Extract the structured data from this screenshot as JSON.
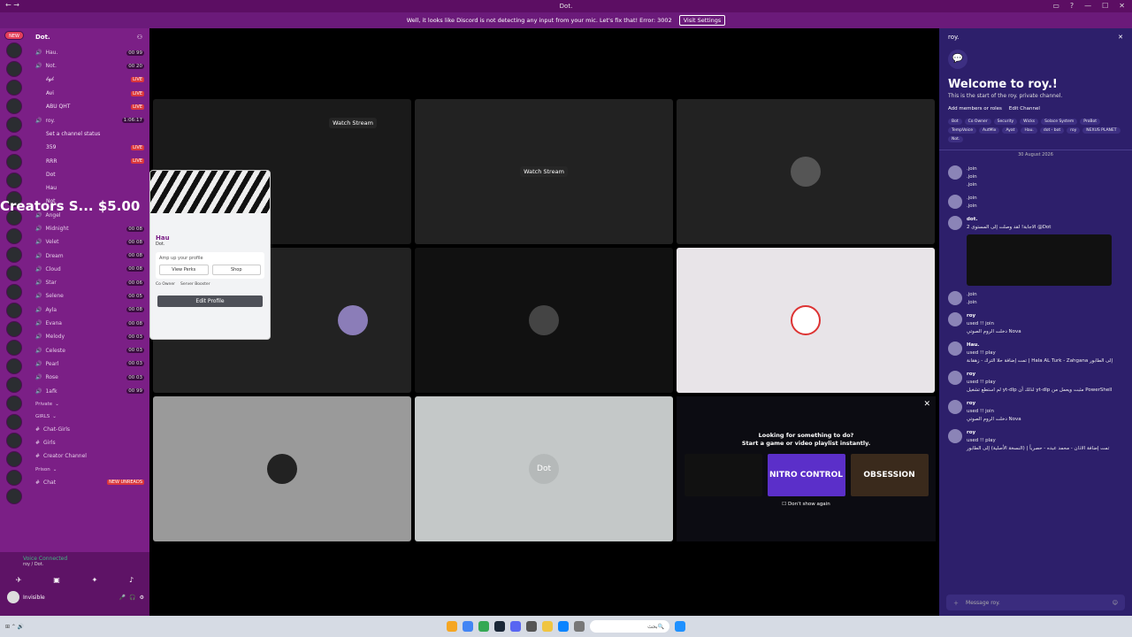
{
  "window": {
    "title": "Dot."
  },
  "banner": {
    "text": "Well, it looks like Discord is not detecting any input from your mic. Let's fix that!  Error: 3002",
    "button": "Visit Settings"
  },
  "servers": {
    "new_label": "NEW"
  },
  "channels": {
    "server_name": "Dot.",
    "items": [
      {
        "name": "Hau.",
        "count": "00 99"
      },
      {
        "name": "Not.",
        "count": "00 20"
      }
    ],
    "voice_users": [
      {
        "name": "𝒷𝓎𝒷",
        "badge": "LIVE"
      },
      {
        "name": "Avi",
        "badge": "LIVE"
      },
      {
        "name": "ABU QHT",
        "badge": "LIVE"
      }
    ],
    "roy_channel": {
      "name": "roy.",
      "timer": "1:06:17",
      "status": "Set a channel status"
    },
    "roy_users": [
      {
        "name": "359",
        "badge": "LIVE"
      },
      {
        "name": "RRR",
        "badge": "LIVE"
      },
      {
        "name": "Dot"
      },
      {
        "name": "Hau"
      },
      {
        "name": "Not"
      }
    ],
    "creators_overlay": "Creators S... $5.00",
    "list": [
      {
        "name": "Angel",
        "count": ""
      },
      {
        "name": "Midnight",
        "count": "00 08"
      },
      {
        "name": "Velet",
        "count": "00 08"
      },
      {
        "name": "Dream",
        "count": "00 08"
      },
      {
        "name": "Cloud",
        "count": "00 08"
      },
      {
        "name": "Star",
        "count": "00 06"
      },
      {
        "name": "Selene",
        "count": "00 05"
      },
      {
        "name": "Ayla",
        "count": "00 08"
      },
      {
        "name": "Evana",
        "count": "00 08"
      },
      {
        "name": "Melody",
        "count": "00 03"
      },
      {
        "name": "Celeste",
        "count": "00 03"
      },
      {
        "name": "Pearl",
        "count": "00 03"
      },
      {
        "name": "Rose",
        "count": "00 03"
      },
      {
        "name": "1afk",
        "count": "00 99"
      }
    ],
    "categories": {
      "private": "Private",
      "girls": "GIRLS",
      "chat_girls": "Chat-Girls",
      "girls2": "Girls",
      "creator_channel": "Creator Channel",
      "prison": "Prison",
      "chat": "Chat",
      "new_unreads": "NEW UNREADS"
    }
  },
  "voice": {
    "status": "Voice Connected",
    "channel": "roy / Dot.",
    "user": "Invisible"
  },
  "tiles": {
    "watch_stream": "Watch Stream",
    "dot_watermark": "Dot"
  },
  "profile": {
    "name": "Hau",
    "tag": "Dot.",
    "amp": "Amp up your profile",
    "view_perks": "View Perks",
    "shop": "Shop",
    "owner": "Co Owner",
    "booster": "Server Booster",
    "edit": "Edit Profile"
  },
  "game_panel": {
    "title": "Looking for something to do?",
    "subtitle": "Start a game or video playlist instantly.",
    "card2": "NITRO CONTROL",
    "card3": "OBSESSION",
    "dont_show": "Don't show again"
  },
  "chat": {
    "channel": "roy.",
    "welcome": "Welcome to roy.!",
    "sub": "This is the start of the roy. private channel.",
    "add_members": "Add members or roles",
    "edit_channel": "Edit Channel",
    "roles": [
      "Bot",
      "Co Owner",
      "Security",
      "Wicks",
      "Solace System",
      "ProBot",
      "TempVoice",
      "AutMix",
      "Ayat",
      "Hau.",
      "dot - bot",
      "roy",
      "NEXUS PLANET",
      "Not."
    ],
    "date": "30 August 2026",
    "messages": [
      {
        "name": "",
        "lines": [
          ".join",
          ".join",
          ".join"
        ]
      },
      {
        "name": "",
        "lines": [
          ".join",
          ".join"
        ]
      },
      {
        "name": "dot.",
        "lines": [
          "الاجابة! لقد وصلت إلى المستوى 2 @Dot"
        ],
        "has_image": true
      },
      {
        "name": "",
        "lines": [
          ".join",
          ".join"
        ]
      },
      {
        "name": "roy",
        "lines": [
          "used !! join",
          "دخلت الروم الصوتي Nova"
        ]
      },
      {
        "name": "Hau.",
        "lines": [
          "used !! play",
          "تمت إضافة حلا الترك - زهقانة | Hala AL Turk - Zahgana إلى الطابور"
        ]
      },
      {
        "name": "roy",
        "lines": [
          "used !! play",
          "لم استطع تشغيل yt-dlp لذلك أن yt-dlp مثبت ويعمل من PowerShell"
        ]
      },
      {
        "name": "roy",
        "lines": [
          "used !! join",
          "دخلت الروم الصوتي Nova"
        ]
      },
      {
        "name": "roy",
        "lines": [
          "used !! play",
          "تمت إضافة الاذان - محمد عبده - حصرياً | (النسخة الأصلية) إلى الطابور"
        ]
      }
    ],
    "input_placeholder": "Message roy."
  },
  "taskbar": {
    "search": "بحث"
  }
}
